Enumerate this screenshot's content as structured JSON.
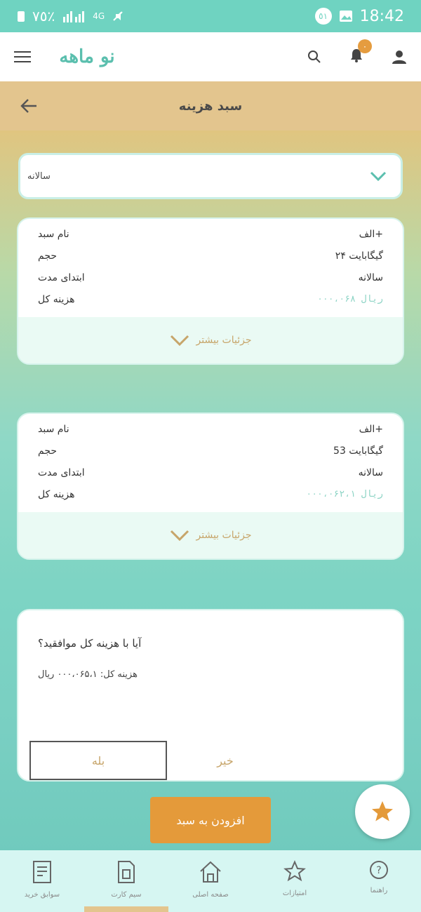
{
  "status_bar": {
    "time": "18:42",
    "badge_count": "٥١",
    "battery": "٧٥٪",
    "network": "4G"
  },
  "header": {
    "logo_text": "نو ماهه",
    "notification_count": "٠"
  },
  "titlebar": {
    "title": "سبد هزینه"
  },
  "selector": {
    "value": "سالانه"
  },
  "cards": [
    {
      "rows": [
        {
          "left": "نام سبد",
          "right": "الف+"
        },
        {
          "left": "حجم",
          "right": "۲۴ گیگابایت"
        },
        {
          "left": "ابتدای مدت",
          "right": "سالانه"
        },
        {
          "left": "هزینه کل",
          "right": "۰۰۰،۰۶۸ ریال"
        }
      ],
      "expand_label": "جزئیات بیشتر"
    },
    {
      "rows": [
        {
          "left": "نام سبد",
          "right": "الف+"
        },
        {
          "left": "حجم",
          "right": "53 گیگابایت"
        },
        {
          "left": "ابتدای مدت",
          "right": "سالانه"
        },
        {
          "left": "هزینه کل",
          "right": "۰۰۰،۰۶۲،۱ ریال"
        }
      ],
      "expand_label": "جزئیات بیشتر"
    }
  ],
  "confirm": {
    "question": "آیا با هزینه کل موافقید؟",
    "total_line": "هزینه کل: ۰۰۰،۰۶۵،۱ ریال",
    "yes_label": "بله",
    "no_label": "خیر"
  },
  "cta": {
    "label": "افزودن به سبد"
  },
  "bottom_nav": [
    {
      "icon": "receipt-icon",
      "label": "سوابق خرید"
    },
    {
      "icon": "sim-card-icon",
      "label": "سیم کارت"
    },
    {
      "icon": "home-icon",
      "label": "صفحه اصلی"
    },
    {
      "icon": "star-icon",
      "label": "امتیازات"
    },
    {
      "icon": "help-icon",
      "label": "راهنما"
    }
  ],
  "colors": {
    "teal": "#6fd3c1",
    "accent_orange": "#e49a3a",
    "title_bar": "#e3c58e"
  }
}
